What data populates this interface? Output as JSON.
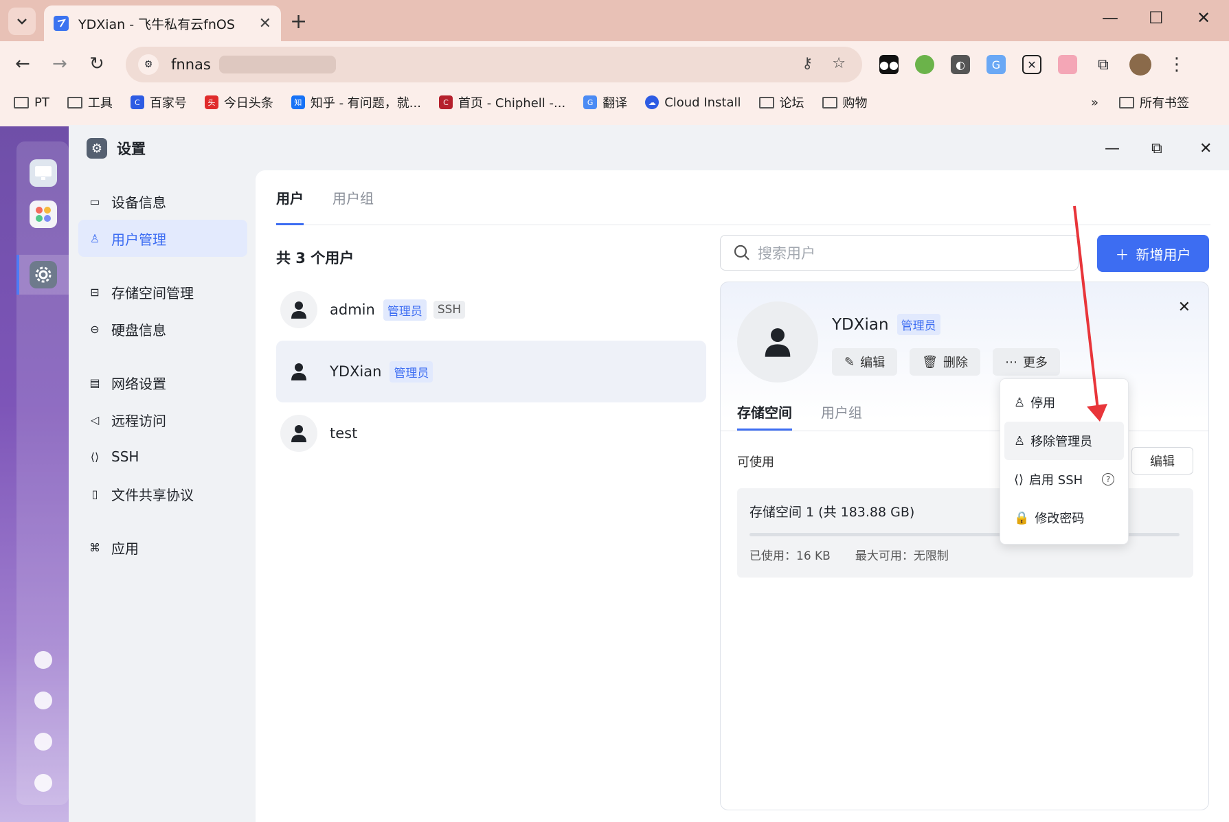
{
  "browser": {
    "tab_title": "YDXian - 飞牛私有云fnOS",
    "address": "fnnas",
    "bookmarks": [
      {
        "label": "PT",
        "icon": "folder-icon"
      },
      {
        "label": "工具",
        "icon": "folder-icon"
      },
      {
        "label": "百家号",
        "icon": "baijiahao-icon"
      },
      {
        "label": "今日头条",
        "icon": "toutiao-icon"
      },
      {
        "label": "知乎 - 有问题，就...",
        "icon": "zhihu-icon"
      },
      {
        "label": "首页 - Chiphell -...",
        "icon": "chiphell-icon"
      },
      {
        "label": "翻译",
        "icon": "translate-icon"
      },
      {
        "label": "Cloud Install",
        "icon": "cloud-icon"
      },
      {
        "label": "论坛",
        "icon": "folder-icon"
      },
      {
        "label": "购物",
        "icon": "folder-icon"
      }
    ],
    "bookmarks_more": "»",
    "all_bookmarks": "所有书签"
  },
  "window": {
    "title": "设置"
  },
  "sidenav": {
    "items": [
      {
        "label": "设备信息",
        "icon": "device-icon"
      },
      {
        "label": "用户管理",
        "icon": "user-icon",
        "active": true
      },
      {
        "label": "存储空间管理",
        "icon": "storage-icon"
      },
      {
        "label": "硬盘信息",
        "icon": "disk-icon"
      },
      {
        "label": "网络设置",
        "icon": "network-icon"
      },
      {
        "label": "远程访问",
        "icon": "send-icon"
      },
      {
        "label": "SSH",
        "icon": "code-icon"
      },
      {
        "label": "文件共享协议",
        "icon": "file-icon"
      },
      {
        "label": "应用",
        "icon": "apps-icon"
      }
    ]
  },
  "main": {
    "tabs": [
      "用户",
      "用户组"
    ],
    "user_count": "共 3 个用户",
    "search_placeholder": "搜索用户",
    "add_user": "新增用户",
    "users": [
      {
        "name": "admin",
        "badges": [
          "管理员",
          "SSH"
        ]
      },
      {
        "name": "YDXian",
        "badges": [
          "管理员"
        ],
        "selected": true
      },
      {
        "name": "test",
        "badges": []
      }
    ]
  },
  "detail": {
    "name": "YDXian",
    "badge": "管理员",
    "actions": {
      "edit": "编辑",
      "delete": "删除",
      "more": "更多"
    },
    "tabs": [
      "存储空间",
      "用户组"
    ],
    "available_label": "可使用",
    "edit_button": "编辑",
    "storage": {
      "title": "存储空间 1 (共 183.88 GB)",
      "used": "已使用：16 KB",
      "max": "最大可用：无限制"
    }
  },
  "menu": {
    "items": [
      "停用",
      "移除管理员",
      "启用 SSH",
      "修改密码"
    ]
  },
  "colors": {
    "accent": "#3d6df2",
    "annotation_arrow": "#e8353a"
  }
}
